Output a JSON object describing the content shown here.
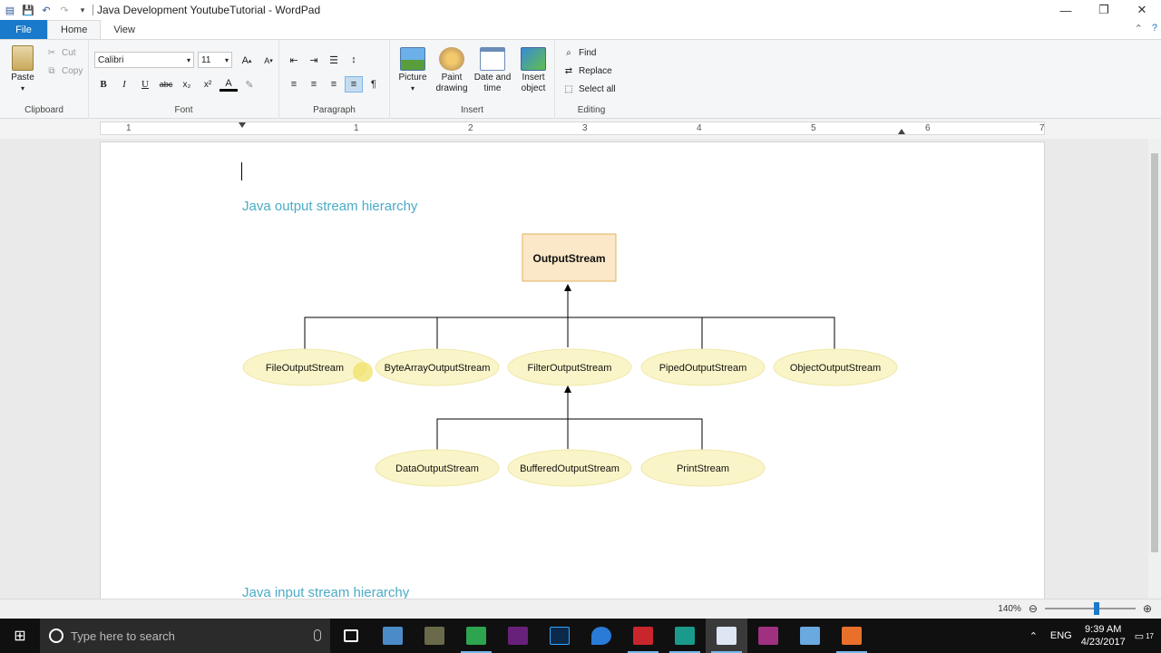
{
  "window": {
    "title": "Java Development YoutubeTutorial - WordPad",
    "controls": {
      "minimize": "—",
      "restore": "❐",
      "close": "✕"
    }
  },
  "tabs": {
    "file": "File",
    "home": "Home",
    "view": "View"
  },
  "ribbon": {
    "clipboard": {
      "label": "Clipboard",
      "paste": "Paste",
      "cut": "Cut",
      "copy": "Copy"
    },
    "font": {
      "label": "Font",
      "family": "Calibri",
      "size": "11",
      "bold": "B",
      "italic": "I",
      "underline": "U",
      "strike": "abc",
      "subscript": "x₂",
      "superscript": "x²",
      "color": "A"
    },
    "paragraph": {
      "label": "Paragraph"
    },
    "insert": {
      "label": "Insert",
      "picture": "Picture",
      "paint_line1": "Paint",
      "paint_line2": "drawing",
      "date_line1": "Date and",
      "date_line2": "time",
      "object_line1": "Insert",
      "object_line2": "object"
    },
    "editing": {
      "label": "Editing",
      "find": "Find",
      "replace": "Replace",
      "select_all": "Select all"
    }
  },
  "ruler": {
    "numbers": [
      "1",
      "1",
      "2",
      "3",
      "4",
      "5",
      "6",
      "7"
    ]
  },
  "document": {
    "heading1": "Java output stream hierarchy",
    "heading2": "Java input stream hierarchy",
    "diagram": {
      "root": "OutputStream",
      "level1": [
        "FileOutputStream",
        "ByteArrayOutputStream",
        "FilterOutputStream",
        "PipedOutputStream",
        "ObjectOutputStream"
      ],
      "level2": [
        "DataOutputStream",
        "BufferedOutputStream",
        "PrintStream"
      ],
      "colors": {
        "root_fill": "#fbe8c8",
        "root_border": "#e0b060",
        "ellipse_fill": "#faf5c8"
      }
    }
  },
  "status": {
    "zoom": "140%"
  },
  "taskbar": {
    "search_placeholder": "Type here to search",
    "language": "ENG",
    "time": "9:39 AM",
    "date": "4/23/2017",
    "notifications": "17"
  }
}
